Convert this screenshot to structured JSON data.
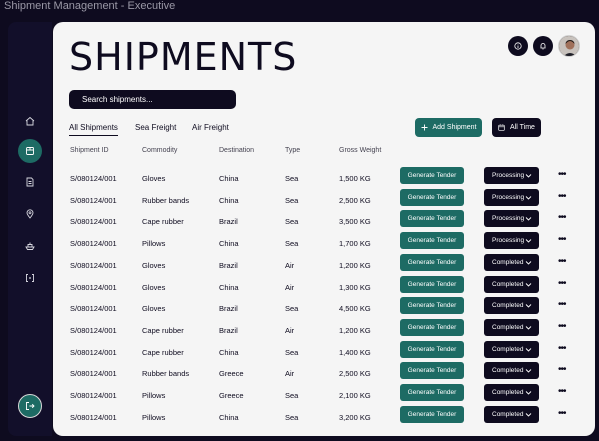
{
  "window": {
    "title": "Shipment Management - Executive"
  },
  "header": {
    "title": "SHIPMENTS",
    "icons": [
      "info-icon",
      "bell-icon",
      "user-avatar"
    ]
  },
  "sidebar": {
    "items": [
      {
        "icon": "home-icon",
        "active": false
      },
      {
        "icon": "package-icon",
        "active": true
      },
      {
        "icon": "document-icon",
        "active": false
      },
      {
        "icon": "location-pin-icon",
        "active": false
      },
      {
        "icon": "ship-icon",
        "active": false
      },
      {
        "icon": "scan-icon",
        "active": false
      }
    ],
    "logout_icon": "logout-icon"
  },
  "search": {
    "placeholder": "Search shipments..."
  },
  "tabs": [
    {
      "label": "All Shipments",
      "active": true
    },
    {
      "label": "Sea Freight",
      "active": false
    },
    {
      "label": "Air Freight",
      "active": false
    }
  ],
  "actions": {
    "add_label": "Add Shipment",
    "time_label": "All Time"
  },
  "table": {
    "columns": [
      "Shipment ID",
      "Commodity",
      "Destination",
      "Type",
      "Gross Weight"
    ],
    "action_label": "Generate Tender",
    "rows": [
      {
        "id": "S/080124/001",
        "commodity": "Gloves",
        "destination": "China",
        "type": "Sea",
        "weight": "1,500 KG",
        "status": "Processing"
      },
      {
        "id": "S/080124/001",
        "commodity": "Rubber bands",
        "destination": "China",
        "type": "Sea",
        "weight": "2,500 KG",
        "status": "Processing"
      },
      {
        "id": "S/080124/001",
        "commodity": "Cape rubber",
        "destination": "Brazil",
        "type": "Sea",
        "weight": "3,500 KG",
        "status": "Processing"
      },
      {
        "id": "S/080124/001",
        "commodity": "Pillows",
        "destination": "China",
        "type": "Sea",
        "weight": "1,700 KG",
        "status": "Processing"
      },
      {
        "id": "S/080124/001",
        "commodity": "Gloves",
        "destination": "Brazil",
        "type": "Air",
        "weight": "1,200 KG",
        "status": "Completed"
      },
      {
        "id": "S/080124/001",
        "commodity": "Gloves",
        "destination": "China",
        "type": "Air",
        "weight": "1,300 KG",
        "status": "Completed"
      },
      {
        "id": "S/080124/001",
        "commodity": "Gloves",
        "destination": "Brazil",
        "type": "Sea",
        "weight": "4,500 KG",
        "status": "Completed"
      },
      {
        "id": "S/080124/001",
        "commodity": "Cape rubber",
        "destination": "Brazil",
        "type": "Air",
        "weight": "1,200 KG",
        "status": "Completed"
      },
      {
        "id": "S/080124/001",
        "commodity": "Cape rubber",
        "destination": "China",
        "type": "Sea",
        "weight": "1,400 KG",
        "status": "Completed"
      },
      {
        "id": "S/080124/001",
        "commodity": "Rubber bands",
        "destination": "Greece",
        "type": "Air",
        "weight": "2,500 KG",
        "status": "Completed"
      },
      {
        "id": "S/080124/001",
        "commodity": "Pillows",
        "destination": "Greece",
        "type": "Sea",
        "weight": "2,100 KG",
        "status": "Completed"
      },
      {
        "id": "S/080124/001",
        "commodity": "Pillows",
        "destination": "China",
        "type": "Sea",
        "weight": "3,200 KG",
        "status": "Completed"
      }
    ]
  },
  "colors": {
    "dark": "#0e0b1f",
    "teal": "#1d6b64",
    "panel": "#f5f5f5"
  }
}
